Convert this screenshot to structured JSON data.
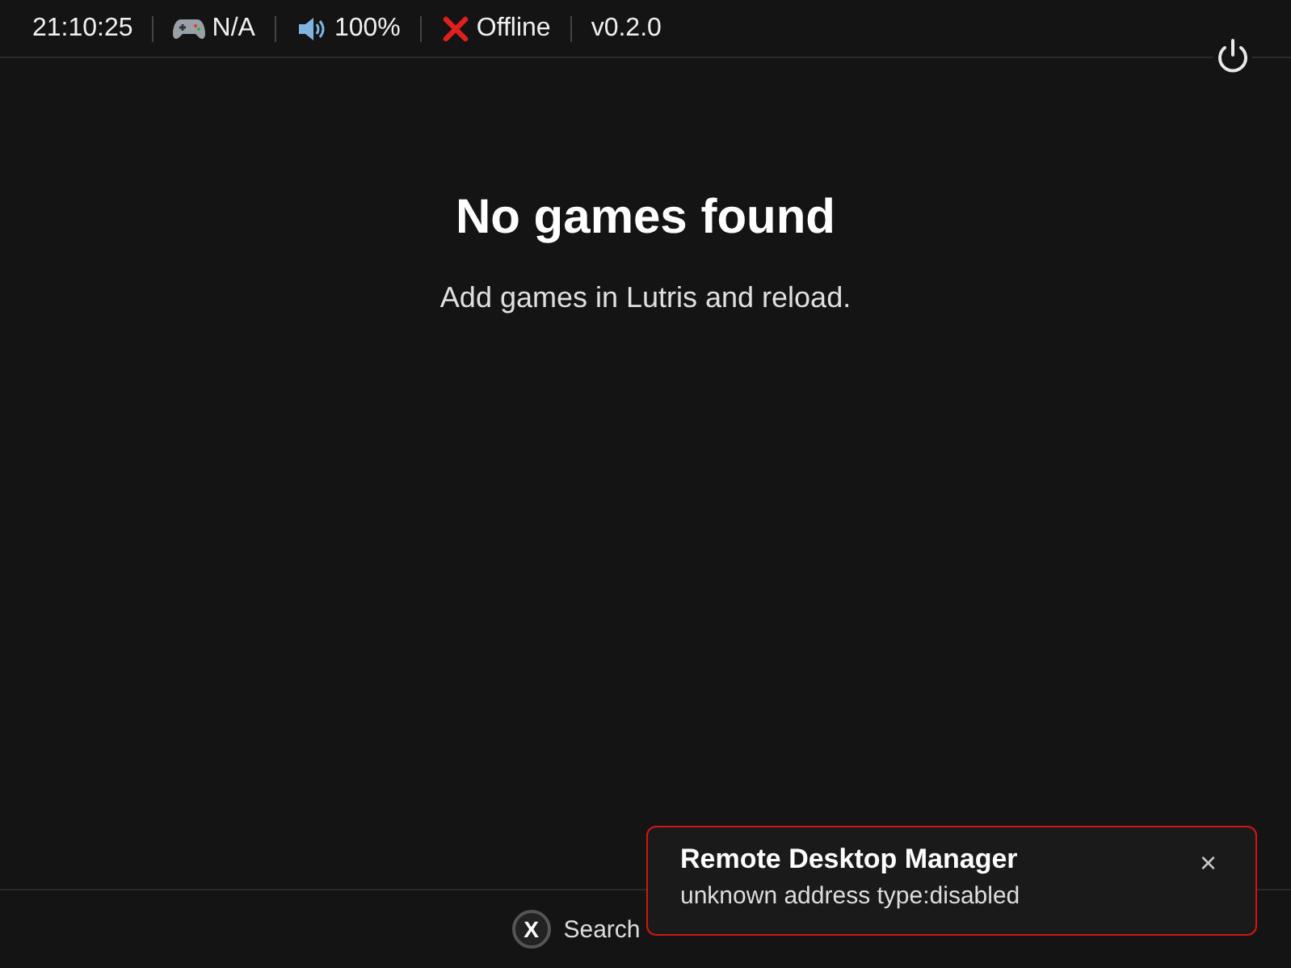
{
  "status_bar": {
    "time": "21:10:25",
    "controller": "N/A",
    "volume": "100%",
    "network": "Offline",
    "version": "v0.2.0"
  },
  "empty_state": {
    "title": "No games found",
    "message": "Add games in Lutris and reload."
  },
  "hints": [
    {
      "key": "X",
      "label": "Search"
    }
  ],
  "toast": {
    "title": "Remote Desktop Manager",
    "message": "unknown address type:disabled",
    "close": "×"
  }
}
